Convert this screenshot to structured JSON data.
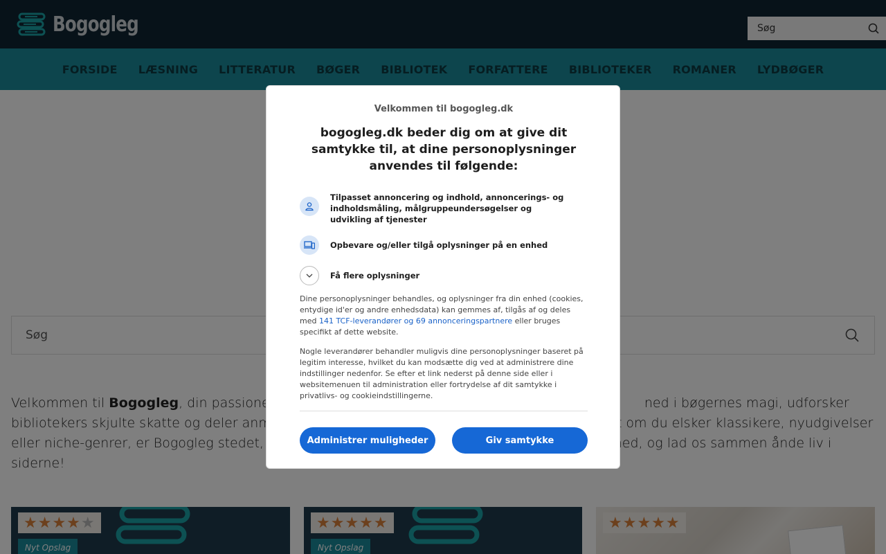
{
  "header": {
    "logo_text": "Bogogleg",
    "search_placeholder": "Søg"
  },
  "nav": {
    "items": [
      "FORSIDE",
      "LÆSNING",
      "LITTERATUR",
      "BØGER",
      "BIBLIOTEK",
      "FORFATTERE",
      "BIBLIOTEKER",
      "ROMANER",
      "LYDBØGER"
    ]
  },
  "main": {
    "search_placeholder": "Søg",
    "intro_part1": "Velkommen til ",
    "intro_brand": "Bogogleg",
    "intro_part2": ", din passionered",
    "intro_part3": "ned i bøgernes magi, udforsker",
    "intro_line2a": "bibliotekers skjulte skatte og deler anmeld",
    "intro_line2b": "t om du elsker klassikere, nyudgivelser",
    "intro_line3a": "eller niche-genrer, er Bogogleg stedet, hv",
    "intro_line3b": "med, og lad os sammen ånde liv i",
    "intro_line4": "siderne!"
  },
  "cards": [
    {
      "rating": 4,
      "max": 5,
      "badge": "Nyt Opslag"
    },
    {
      "rating": 5,
      "max": 5,
      "badge": "Nyt Opslag"
    },
    {
      "rating": 5,
      "max": 5,
      "badge": ""
    }
  ],
  "consent": {
    "welcome": "Velkommen til bogogleg.dk",
    "headline": "bogogleg.dk beder dig om at give dit samtykke til, at dine personoplysninger anvendes til følgende:",
    "purpose1": "Tilpasset annoncering og indhold, annoncerings- og indholdsmåling, målgruppeundersøgelser og udvikling af tjenester",
    "purpose2": "Opbevare og/eller tilgå oplysninger på en enhed",
    "more_info": "Få flere oplysninger",
    "disclaimer1_a": "Dine personoplysninger behandles, og oplysninger fra din enhed (cookies, entydige id'er og andre enhedsdata) kan gemmes af, tilgås af og deles med ",
    "disclaimer1_link": "141 TCF-leverandører og 69 annonceringspartnere",
    "disclaimer1_b": " eller bruges specifikt af dette website.",
    "disclaimer2": "Nogle leverandører behandler muligvis dine personoplysninger baseret på legitim interesse, hvilket du kan modsætte dig ved at administrere dine indstillinger nedenfor. Se efter et link nederst på denne side eller i websitemenuen til administration eller fortrydelse af dit samtykke i privatlivs- og cookieindstillingerne.",
    "manage_button": "Administrer muligheder",
    "consent_button": "Giv samtykke"
  },
  "colors": {
    "topbar": "#0f2433",
    "navbar": "#1a8a9b",
    "primary_button": "#1668d6",
    "star": "#d9813b"
  }
}
